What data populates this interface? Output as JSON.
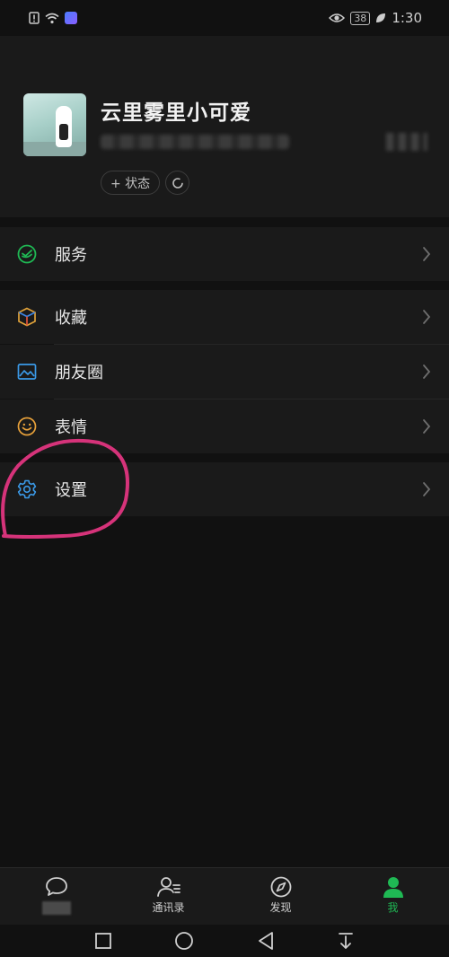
{
  "status_bar": {
    "time": "1:30",
    "battery": "38",
    "left_icons": [
      "alert-sim-icon",
      "wifi-icon",
      "music-app-icon"
    ],
    "right_icons": [
      "eye-icon",
      "battery-icon",
      "leaf-icon"
    ]
  },
  "profile": {
    "nickname": "云里雾里小可爱",
    "status_chip_label": "+ 状态"
  },
  "menu": {
    "services": {
      "label": "服务",
      "icon": "wechat-pay-icon"
    },
    "favorites": {
      "label": "收藏",
      "icon": "cube-icon"
    },
    "moments": {
      "label": "朋友圈",
      "icon": "image-icon"
    },
    "stickers": {
      "label": "表情",
      "icon": "smiley-icon"
    },
    "settings": {
      "label": "设置",
      "icon": "gear-icon"
    }
  },
  "tabbar": {
    "tabs": [
      {
        "label": "",
        "icon": "chat-bubble-icon"
      },
      {
        "label": "通讯录",
        "icon": "contacts-icon"
      },
      {
        "label": "发现",
        "icon": "compass-icon"
      },
      {
        "label": "我",
        "icon": "person-icon"
      }
    ],
    "active_index": 3,
    "active_color": "#1fb954"
  },
  "annotation": {
    "circle_color": "#d6337a"
  }
}
